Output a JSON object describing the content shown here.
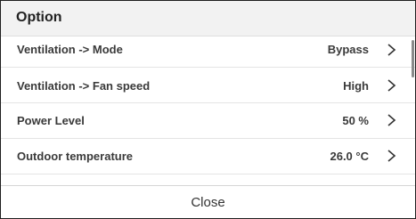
{
  "dialog": {
    "title": "Option"
  },
  "rows": [
    {
      "label": "Ventilation -> Mode",
      "value": "Bypass",
      "icon": "chevron-right-icon"
    },
    {
      "label": "Ventilation -> Fan speed",
      "value": "High",
      "icon": "chevron-right-icon"
    },
    {
      "label": "Power Level",
      "value": "50 %",
      "icon": "chevron-right-icon"
    },
    {
      "label": "Outdoor temperature",
      "value": "26.0 °C",
      "icon": "chevron-right-icon"
    }
  ],
  "footer": {
    "close_label": "Close"
  }
}
